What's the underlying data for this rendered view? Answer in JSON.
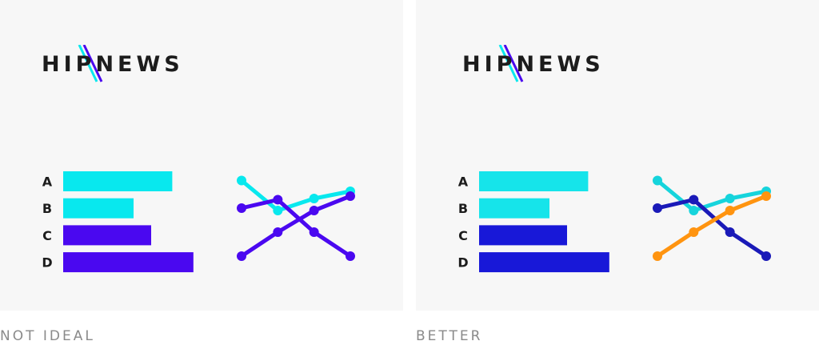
{
  "panels": [
    {
      "logo": {
        "part1": "HIP",
        "part2": "NEWS"
      },
      "caption": "NOT IDEAL",
      "chart_data": {
        "type": "bar",
        "categories": [
          "A",
          "B",
          "C",
          "D"
        ],
        "values": [
          62,
          40,
          50,
          74
        ],
        "bar_colors": [
          "#08e8ee",
          "#08e8ee",
          "#4a08f0",
          "#4a08f0"
        ]
      },
      "line_chart": {
        "type": "line",
        "x": [
          1,
          2,
          3,
          4
        ],
        "series": [
          {
            "values": [
              8.3,
              5.8,
              6.8,
              7.4
            ],
            "color": "#08e8ee"
          },
          {
            "values": [
              6.0,
              6.7,
              4.0,
              2.0
            ],
            "color": "#4a08f0"
          },
          {
            "values": [
              2.0,
              4.0,
              5.8,
              7.0
            ],
            "color": "#4a08f0"
          }
        ],
        "ylim": [
          0,
          10
        ]
      }
    },
    {
      "logo": {
        "part1": "HIP",
        "part2": "NEWS"
      },
      "caption": "BETTER",
      "chart_data": {
        "type": "bar",
        "categories": [
          "A",
          "B",
          "C",
          "D"
        ],
        "values": [
          62,
          40,
          50,
          74
        ],
        "bar_colors": [
          "#16e4ea",
          "#16e4ea",
          "#1818d8",
          "#1818d8"
        ]
      },
      "line_chart": {
        "type": "line",
        "x": [
          1,
          2,
          3,
          4
        ],
        "series": [
          {
            "values": [
              8.3,
              5.8,
              6.8,
              7.4
            ],
            "color": "#16d4dc"
          },
          {
            "values": [
              6.0,
              6.7,
              4.0,
              2.0
            ],
            "color": "#1a1ab8"
          },
          {
            "values": [
              2.0,
              4.0,
              5.8,
              7.0
            ],
            "color": "#ff9410"
          }
        ],
        "ylim": [
          0,
          10
        ]
      }
    }
  ],
  "colors": {
    "logo_text": "#1c1c1c",
    "slash_cyan": "#08e8ee",
    "slash_blue": "#4a08f0",
    "caption": "#8a8a8a",
    "panel_bg": "#f7f7f7"
  }
}
